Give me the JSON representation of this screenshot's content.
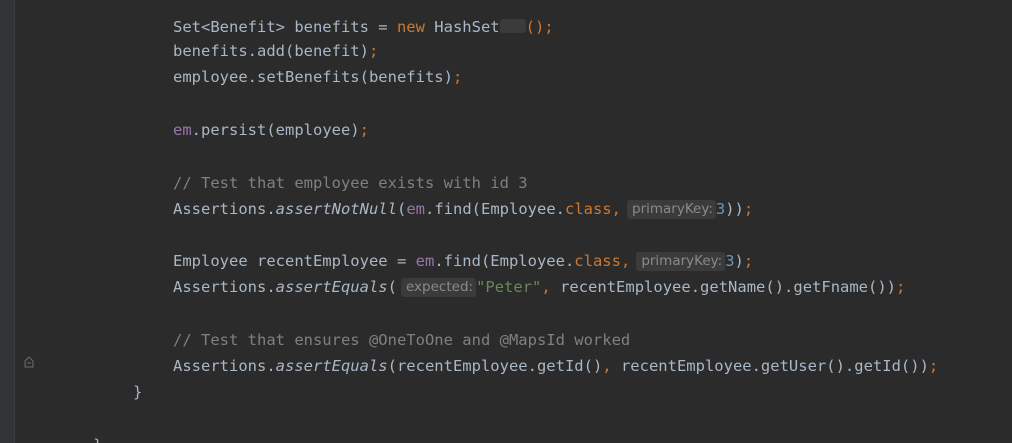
{
  "editor": {
    "line_top_partial": {
      "type": "Set<Benefit>",
      "var": " benefits = ",
      "kw_new": "new",
      "cls": " HashSet",
      "end": "();"
    },
    "lines": {
      "l1a": "benefits.add(benefit)",
      "l1b": ";",
      "l2a": "employee.setBenefits(benefits)",
      "l2b": ";",
      "l3a": "em",
      "l3b": ".persist(employee)",
      "l3c": ";",
      "l4": "// Test that employee exists with id 3",
      "l5a": "Assertions.",
      "l5b": "assertNotNull",
      "l5c": "(",
      "l5d": "em",
      "l5e": ".find(Employee.",
      "l5f": "class",
      "l5g": ",",
      "l5hint": "primaryKey:",
      "l5h": "3",
      "l5i": "))",
      "l5j": ";",
      "l6a": "Employee recentEmployee = ",
      "l6b": "em",
      "l6c": ".find(Employee.",
      "l6d": "class",
      "l6e": ",",
      "l6hint": "primaryKey:",
      "l6f": "3",
      "l6g": ")",
      "l6h": ";",
      "l7a": "Assertions.",
      "l7b": "assertEquals",
      "l7c": "(",
      "l7hint": "expected:",
      "l7d": "\"Peter\"",
      "l7e": ",",
      "l7f": " recentEmployee.getName().getFname())",
      "l7g": ";",
      "l8": "// Test that ensures @OneToOne and @MapsId worked",
      "l9a": "Assertions.",
      "l9b": "assertEquals",
      "l9c": "(recentEmployee.getId()",
      "l9d": ",",
      "l9e": " recentEmployee.getUser().getId())",
      "l9f": ";",
      "l10": "}",
      "l11": "}"
    }
  },
  "colors": {
    "background": "#2b2b2b",
    "default_text": "#a9b7c6",
    "keyword": "#cc7832",
    "field": "#9876aa",
    "comment": "#808080",
    "number": "#6897bb",
    "string": "#6a8759",
    "hint_text": "#8a8a8a",
    "hint_bg": "#3b3b3b"
  },
  "icons": {
    "fold": "fold-marker-icon"
  }
}
